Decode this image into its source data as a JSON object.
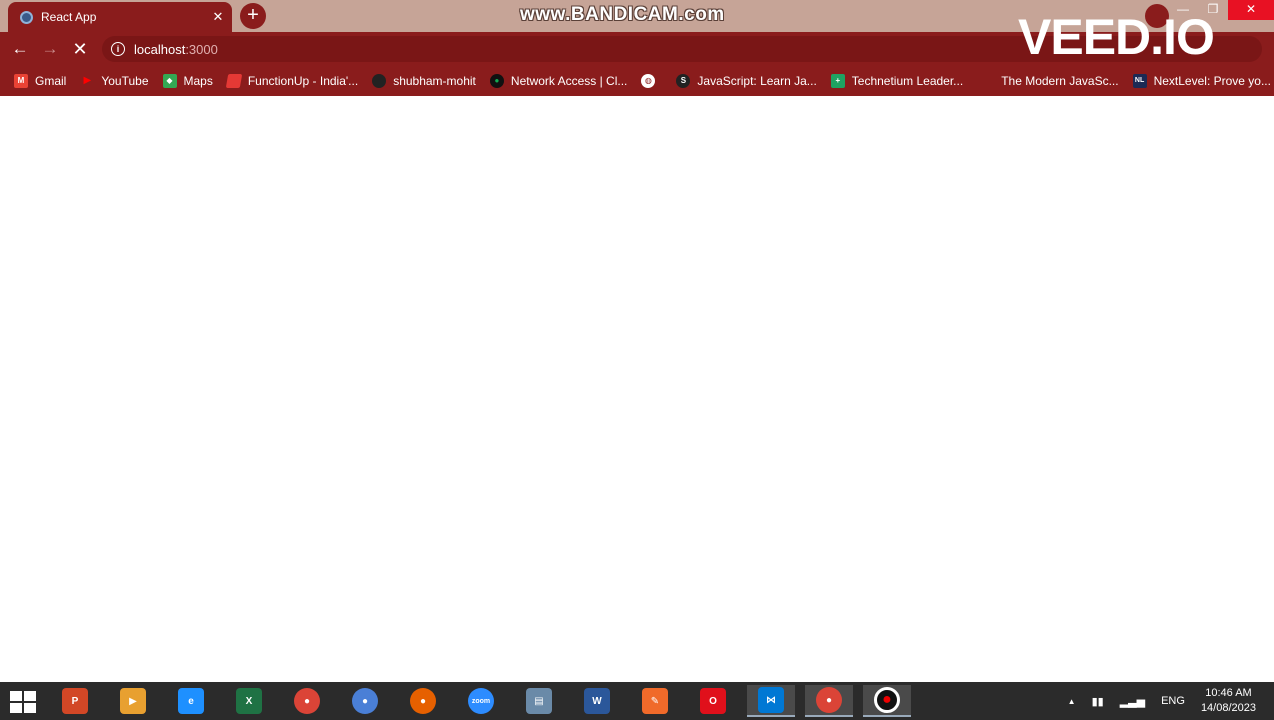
{
  "browser": {
    "tab": {
      "title": "React App",
      "close_glyph": "✕"
    },
    "new_tab_glyph": "+",
    "address": {
      "host": "localhost",
      "port": ":3000"
    },
    "nav": {
      "back_glyph": "←",
      "forward_glyph": "→",
      "stop_glyph": "✕",
      "info_glyph": "i"
    },
    "window_controls": {
      "minimize": "—",
      "restore": "❐",
      "close": "✕"
    }
  },
  "watermarks": {
    "bandicam": "www.BANDICAM.com",
    "veed": "VEED.IO"
  },
  "bookmarks": [
    {
      "label": "Gmail",
      "icon": "gmail-icon",
      "glyph": "M"
    },
    {
      "label": "YouTube",
      "icon": "youtube-icon",
      "glyph": "▶"
    },
    {
      "label": "Maps",
      "icon": "maps-icon",
      "glyph": "◆"
    },
    {
      "label": "FunctionUp - India'...",
      "icon": "functionup-icon",
      "glyph": ""
    },
    {
      "label": "shubham-mohit",
      "icon": "github-icon",
      "glyph": ""
    },
    {
      "label": "Network Access | Cl...",
      "icon": "mongodb-icon",
      "glyph": "●"
    },
    {
      "label": "",
      "icon": "globe-icon",
      "glyph": "◍"
    },
    {
      "label": "JavaScript: Learn Ja...",
      "icon": "javascript-icon",
      "glyph": "S"
    },
    {
      "label": "Technetium Leader...",
      "icon": "technetium-icon",
      "glyph": "+"
    },
    {
      "label": "The Modern JavaSc...",
      "icon": "modern-js-icon",
      "glyph": ""
    },
    {
      "label": "NextLevel: Prove yo...",
      "icon": "nextlevel-icon",
      "glyph": "NL"
    }
  ],
  "taskbar": {
    "apps": [
      {
        "name": "powerpoint-icon",
        "color": "#d24726",
        "glyph": "P"
      },
      {
        "name": "media-player-icon",
        "color": "#e8a030",
        "glyph": "▶"
      },
      {
        "name": "internet-explorer-icon",
        "color": "#1e90ff",
        "glyph": "e"
      },
      {
        "name": "excel-icon",
        "color": "#1f7244",
        "glyph": "X"
      },
      {
        "name": "chrome-icon",
        "color": "#db4437",
        "glyph": "●"
      },
      {
        "name": "chromium-icon",
        "color": "#4a7fd6",
        "glyph": "●"
      },
      {
        "name": "firefox-icon",
        "color": "#e66000",
        "glyph": "●"
      },
      {
        "name": "zoom-icon",
        "color": "#2d8cff",
        "glyph": "zoom"
      },
      {
        "name": "notepad-icon",
        "color": "#6a8aa8",
        "glyph": "▤"
      },
      {
        "name": "word-icon",
        "color": "#2b579a",
        "glyph": "W"
      },
      {
        "name": "pen-app-icon",
        "color": "#f06a2a",
        "glyph": "✎"
      },
      {
        "name": "opera-icon",
        "color": "#e0101b",
        "glyph": "O"
      },
      {
        "name": "vscode-icon",
        "color": "#0078d4",
        "glyph": "⋈"
      },
      {
        "name": "chrome-profile-icon",
        "color": "#db4437",
        "glyph": "●"
      },
      {
        "name": "bandicam-record-icon",
        "color": "#111111",
        "glyph": "●"
      }
    ],
    "tray": {
      "language": "ENG",
      "time": "10:46 AM",
      "date": "14/08/2023",
      "overflow_glyph": "▲"
    }
  }
}
